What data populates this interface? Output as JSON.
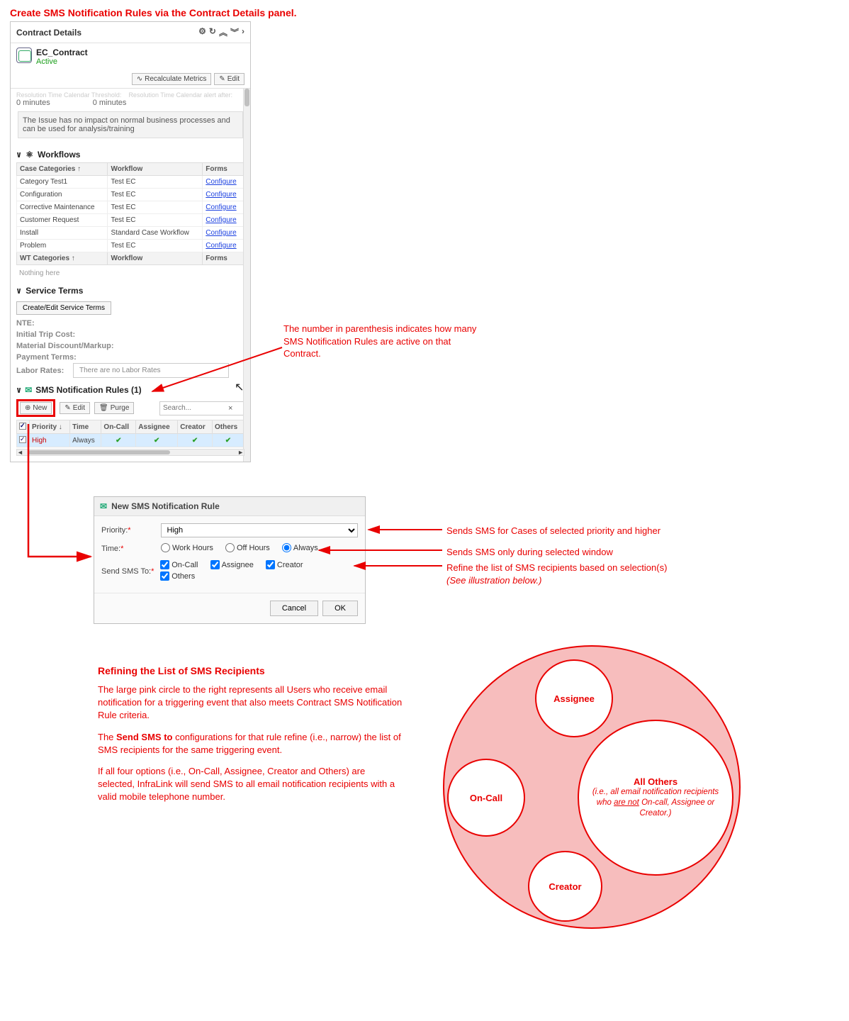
{
  "top_title": "Create SMS Notification Rules via the Contract Details panel.",
  "panel": {
    "title": "Contract Details",
    "contract_name": "EC_Contract",
    "contract_status": "Active",
    "recalc_btn": "Recalculate Metrics",
    "edit_btn": "Edit",
    "truncated_label_left": "Resolution Time Calendar Threshold:",
    "truncated_label_right": "Resolution Time Calendar alert after:",
    "zero_min_left": "0 minutes",
    "zero_min_right": "0 minutes",
    "info_box": "The Issue has no impact on normal business processes and can be used for analysis/training"
  },
  "workflows": {
    "title": "Workflows",
    "col_case": "Case Categories",
    "col_wf": "Workflow",
    "col_forms": "Forms",
    "rows": [
      {
        "cat": "Category Test1",
        "wf": "Test EC",
        "form": "Configure"
      },
      {
        "cat": "Configuration",
        "wf": "Test EC",
        "form": "Configure"
      },
      {
        "cat": "Corrective Maintenance",
        "wf": "Test EC",
        "form": "Configure"
      },
      {
        "cat": "Customer Request",
        "wf": "Test EC",
        "form": "Configure"
      },
      {
        "cat": "Install",
        "wf": "Standard Case Workflow",
        "form": "Configure"
      },
      {
        "cat": "Problem",
        "wf": "Test EC",
        "form": "Configure"
      }
    ],
    "col_wt": "WT Categories",
    "nothing": "Nothing here"
  },
  "service_terms": {
    "title": "Service Terms",
    "btn": "Create/Edit Service Terms",
    "nte": "NTE:",
    "trip": "Initial Trip Cost:",
    "material": "Material Discount/Markup:",
    "payment": "Payment Terms:",
    "labor": "Labor Rates:",
    "labor_empty": "There are no Labor Rates"
  },
  "sms": {
    "title": "SMS Notification Rules (1)",
    "btn_new": "New",
    "btn_edit": "Edit",
    "btn_purge": "Purge",
    "search_placeholder": "Search...",
    "cols": {
      "priority": "Priority",
      "time": "Time",
      "oncall": "On-Call",
      "assignee": "Assignee",
      "creator": "Creator",
      "others": "Others"
    },
    "row": {
      "priority": "High",
      "time": "Always"
    }
  },
  "anno_count": "The number in parenthesis indicates how many SMS Notification Rules are active on that Contract.",
  "dialog": {
    "title": "New SMS Notification Rule",
    "priority_label": "Priority:",
    "priority_value": "High",
    "time_label": "Time:",
    "time_opts": {
      "work": "Work Hours",
      "off": "Off Hours",
      "always": "Always"
    },
    "send_label": "Send SMS To:",
    "send_opts": {
      "oncall": "On-Call",
      "assignee": "Assignee",
      "creator": "Creator",
      "others": "Others"
    },
    "cancel": "Cancel",
    "ok": "OK"
  },
  "dlg_anno": {
    "priority": "Sends SMS for Cases of selected priority and higher",
    "time": "Sends SMS only during selected window",
    "send1": "Refine the list of SMS recipients based on selection(s)",
    "send2": "(See illustration below.)"
  },
  "refine": {
    "heading": "Refining the List of SMS Recipients",
    "p1": "The large pink circle to the right represents all Users who receive email notification for a triggering event that also meets Contract SMS Notification Rule criteria.",
    "p2a": "The ",
    "p2b": "Send SMS to",
    "p2c": " configurations for that rule refine (i.e., narrow) the list of SMS recipients for the same triggering event.",
    "p3": "If all four options (i.e., On-Call, Assignee, Creator and Others) are selected, InfraLink will send SMS  to all email notification recipients with a valid mobile telephone number."
  },
  "venn": {
    "assignee": "Assignee",
    "oncall": "On-Call",
    "creator": "Creator",
    "others_t": "All Others",
    "others_d1": "(i.e., all email notification recipients who ",
    "others_u": "are not",
    "others_d2": " On-call, Assignee or Creator.)"
  }
}
